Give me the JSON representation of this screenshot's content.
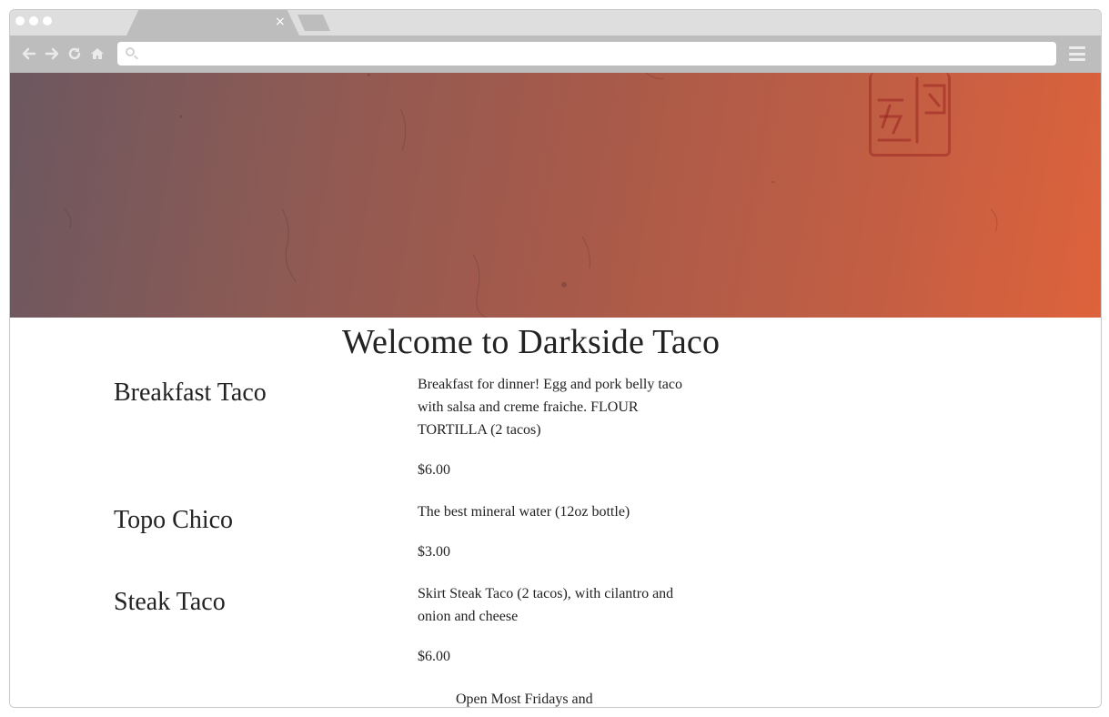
{
  "browser": {
    "tab_close_glyph": "×",
    "address": "",
    "icons": [
      "back-icon",
      "forward-icon",
      "reload-icon",
      "home-icon",
      "search-icon",
      "menu-icon"
    ]
  },
  "hero": {
    "gradient_colors": [
      "#6c5860",
      "#8f5a53",
      "#a75a4a",
      "#c15e44",
      "#de623b"
    ]
  },
  "page": {
    "title": "Welcome to Darkside Taco",
    "footer_note": "Open Most Fridays and"
  },
  "menu": [
    {
      "name": "Breakfast Taco",
      "description": "Breakfast for dinner! Egg and pork belly taco with salsa and creme fraiche. FLOUR TORTILLA (2 tacos)",
      "price": "$6.00"
    },
    {
      "name": "Topo Chico",
      "description": "The best mineral water (12oz bottle)",
      "price": "$3.00"
    },
    {
      "name": "Steak Taco",
      "description": "Skirt Steak Taco (2 tacos), with cilantro and onion and cheese",
      "price": "$6.00"
    }
  ]
}
